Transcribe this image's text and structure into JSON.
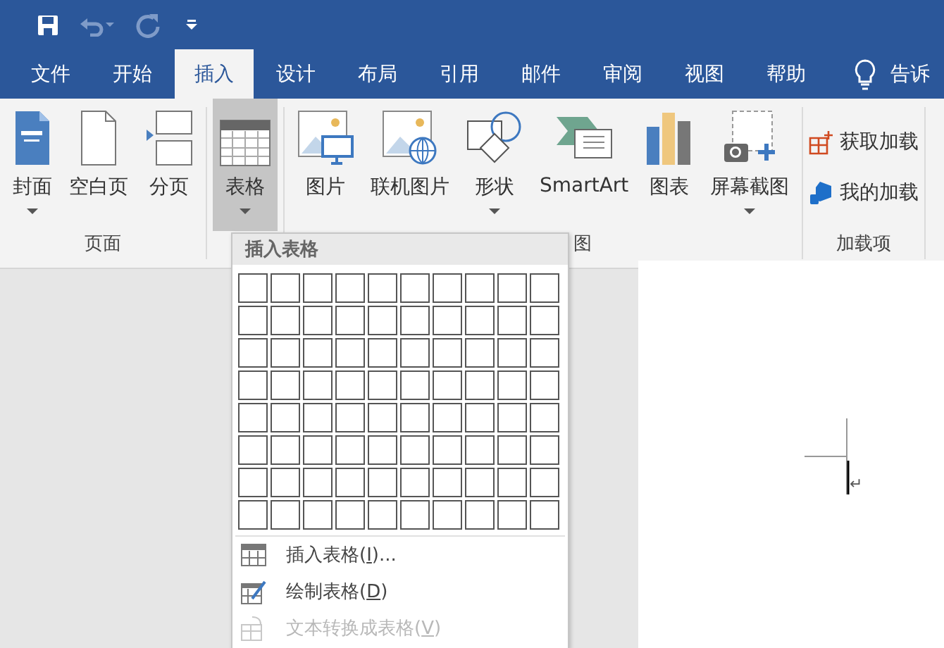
{
  "quick_access": [
    {
      "kind": "save",
      "disabled": false
    },
    {
      "kind": "undo",
      "disabled": true
    },
    {
      "kind": "redo",
      "disabled": true
    },
    {
      "kind": "customize",
      "disabled": false
    }
  ],
  "tabs": [
    {
      "label": "文件",
      "selected": false
    },
    {
      "label": "开始",
      "selected": false
    },
    {
      "label": "插入",
      "selected": true
    },
    {
      "label": "设计",
      "selected": false
    },
    {
      "label": "布局",
      "selected": false
    },
    {
      "label": "引用",
      "selected": false
    },
    {
      "label": "邮件",
      "selected": false
    },
    {
      "label": "审阅",
      "selected": false
    },
    {
      "label": "视图",
      "selected": false
    },
    {
      "label": "帮助",
      "selected": false
    }
  ],
  "tell_me": "告诉",
  "ribbon_groups": [
    {
      "label": "页面",
      "buttons": [
        {
          "kind": "cover",
          "label": "封面",
          "dropdown": true,
          "selected": false
        },
        {
          "kind": "blank",
          "label": "空白页",
          "dropdown": false,
          "selected": false
        },
        {
          "kind": "break",
          "label": "分页",
          "dropdown": false,
          "selected": false
        }
      ]
    },
    {
      "buttons": [
        {
          "kind": "table",
          "label": "表格",
          "dropdown": true,
          "selected": true
        }
      ]
    },
    {
      "label": "图",
      "buttons": [
        {
          "kind": "picture",
          "label": "图片",
          "dropdown": false,
          "selected": false
        },
        {
          "kind": "online",
          "label": "联机图片",
          "dropdown": false,
          "selected": false
        },
        {
          "kind": "shapes",
          "label": "形状",
          "dropdown": true,
          "selected": false
        },
        {
          "kind": "smartart",
          "label": "SmartArt",
          "dropdown": false,
          "selected": false
        },
        {
          "kind": "chart",
          "label": "图表",
          "dropdown": false,
          "selected": false
        },
        {
          "kind": "screenshot",
          "label": "屏幕截图",
          "dropdown": true,
          "selected": false
        }
      ]
    },
    {
      "label": "加载项",
      "small_buttons": [
        {
          "kind": "store",
          "label": "获取加载"
        },
        {
          "kind": "myaddins",
          "label": "我的加载"
        }
      ]
    }
  ],
  "table_menu": {
    "title": "插入表格",
    "items": [
      {
        "kind": "insert",
        "before": "插入表格(",
        "accel": "I",
        "after": ")...",
        "disabled": false
      },
      {
        "kind": "draw",
        "before": "绘制表格(",
        "accel": "D",
        "after": ")",
        "disabled": false
      },
      {
        "kind": "convert",
        "before": "文本转换成表格(",
        "accel": "V",
        "after": ")",
        "disabled": true
      }
    ]
  },
  "document": {
    "paragraph_mark": "↵"
  }
}
